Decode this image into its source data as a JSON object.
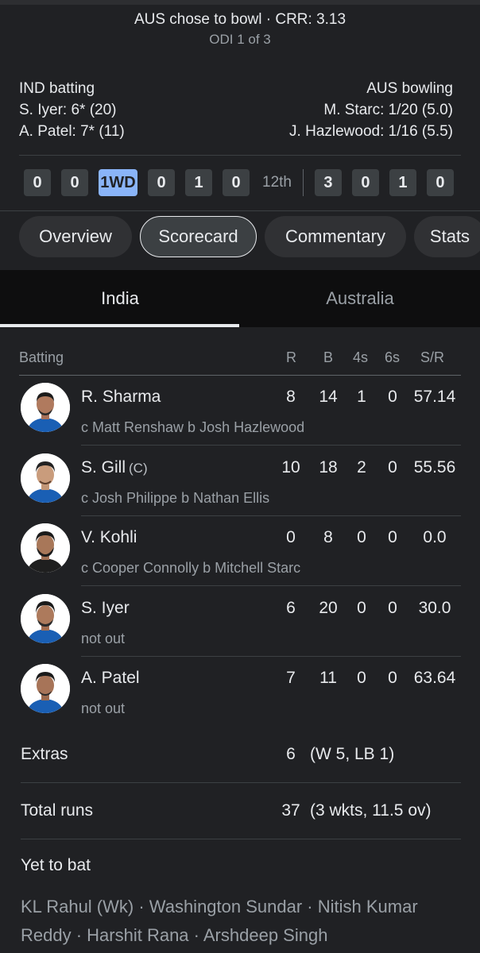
{
  "match": {
    "status": "AUS chose to bowl · CRR: 3.13",
    "series": "ODI 1 of 3"
  },
  "batting_side": {
    "title": "IND batting",
    "batters": [
      "S. Iyer: 6* (20)",
      "A. Patel: 7* (11)"
    ]
  },
  "bowling_side": {
    "title": "AUS bowling",
    "bowlers": [
      "M. Starc: 1/20 (5.0)",
      "J. Hazlewood: 1/16 (5.5)"
    ]
  },
  "balls": {
    "current": [
      "0",
      "0",
      "1WD",
      "0",
      "1",
      "0"
    ],
    "over_label": "12th",
    "previous": [
      "3",
      "0",
      "1",
      "0"
    ]
  },
  "tabs": [
    "Overview",
    "Scorecard",
    "Commentary",
    "Stats"
  ],
  "active_tab": "Scorecard",
  "team_tabs": [
    "India",
    "Australia"
  ],
  "active_team": "India",
  "columns": {
    "batting": "Batting",
    "r": "R",
    "b": "B",
    "fours": "4s",
    "sixes": "6s",
    "sr": "S/R"
  },
  "batters": [
    {
      "name": "R. Sharma",
      "captain": "",
      "dismissal": "c Matt Renshaw b Josh Hazlewood",
      "r": "8",
      "b": "14",
      "fours": "1",
      "sixes": "0",
      "sr": "57.14"
    },
    {
      "name": "S. Gill",
      "captain": "(C)",
      "dismissal": "c Josh Philippe b Nathan Ellis",
      "r": "10",
      "b": "18",
      "fours": "2",
      "sixes": "0",
      "sr": "55.56"
    },
    {
      "name": "V. Kohli",
      "captain": "",
      "dismissal": "c Cooper Connolly b Mitchell Starc",
      "r": "0",
      "b": "8",
      "fours": "0",
      "sixes": "0",
      "sr": "0.0"
    },
    {
      "name": "S. Iyer",
      "captain": "",
      "dismissal": "not out",
      "r": "6",
      "b": "20",
      "fours": "0",
      "sixes": "0",
      "sr": "30.0"
    },
    {
      "name": "A. Patel",
      "captain": "",
      "dismissal": "not out",
      "r": "7",
      "b": "11",
      "fours": "0",
      "sixes": "0",
      "sr": "63.64"
    }
  ],
  "extras": {
    "label": "Extras",
    "value": "6",
    "detail": "(W 5, LB 1)"
  },
  "total": {
    "label": "Total runs",
    "value": "37",
    "detail": "(3 wkts, 11.5 ov)"
  },
  "yet_to_bat": {
    "label": "Yet to bat",
    "players": "KL Rahul (Wk) · Washington Sundar · Nitish Kumar Reddy · Harshit Rana · Arshdeep Singh"
  },
  "colors": {
    "background": "#202124",
    "accent_ball": "#8ab4f8",
    "jersey": "#1a5fb4"
  }
}
